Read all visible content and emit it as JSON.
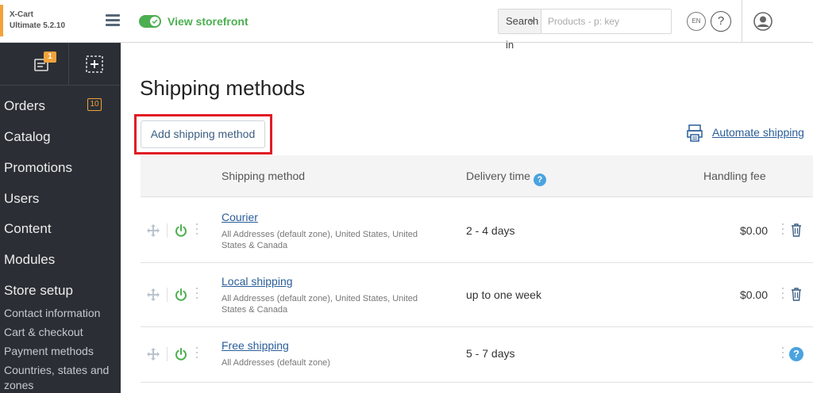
{
  "brand": {
    "line1": "X-Cart",
    "line2": "Ultimate 5.2.10"
  },
  "header": {
    "storefront_label": "View storefront",
    "search_scope": "Search in",
    "search_placeholder": "Products - p: key",
    "language": "EN",
    "help": "?"
  },
  "sidebar": {
    "notification_count": "1",
    "items": [
      {
        "label": "Orders",
        "count": "10"
      },
      {
        "label": "Catalog"
      },
      {
        "label": "Promotions"
      },
      {
        "label": "Users"
      },
      {
        "label": "Content"
      },
      {
        "label": "Modules"
      },
      {
        "label": "Store setup"
      }
    ],
    "subitems": [
      {
        "label": "Contact information"
      },
      {
        "label": "Cart & checkout"
      },
      {
        "label": "Payment methods"
      },
      {
        "label": "Countries, states and zones"
      }
    ]
  },
  "main": {
    "title": "Shipping methods",
    "add_button": "Add shipping method",
    "automate_link": "Automate shipping",
    "columns": {
      "method": "Shipping method",
      "delivery": "Delivery time",
      "fee": "Handling fee"
    },
    "rows": [
      {
        "name": "Courier",
        "zones": "All Addresses (default zone), United States, United States & Canada",
        "delivery": "2 - 4 days",
        "fee": "$0.00"
      },
      {
        "name": "Local shipping",
        "zones": "All Addresses (default zone), United States, United States & Canada",
        "delivery": "up to one week",
        "fee": "$0.00"
      },
      {
        "name": "Free shipping",
        "zones": "All Addresses (default zone)",
        "delivery": "5 - 7 days",
        "fee": ""
      }
    ]
  },
  "colors": {
    "accent_green": "#4caf50",
    "sidebar_bg": "#2b2f35",
    "badge_orange": "#f2a23a",
    "link_blue": "#2a5d99",
    "highlight_red": "#e01b24"
  }
}
